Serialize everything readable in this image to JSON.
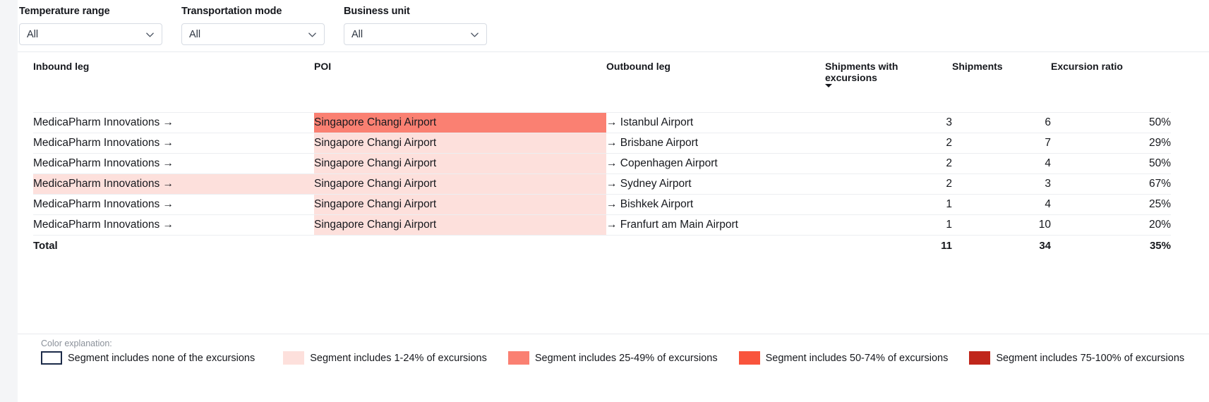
{
  "filters": [
    {
      "label": "Temperature range",
      "value": "All",
      "icon": "chevron-down-icon",
      "name": "temperature-range"
    },
    {
      "label": "Transportation mode",
      "value": "All",
      "icon": "chevron-down-icon",
      "name": "transportation-mode"
    },
    {
      "label": "Business unit",
      "value": "All",
      "icon": "chevron-down-icon",
      "name": "business-unit"
    }
  ],
  "table": {
    "columns": [
      {
        "label": "Inbound leg",
        "align": "left"
      },
      {
        "label": "POI",
        "align": "left"
      },
      {
        "label": "Outbound leg",
        "align": "left"
      },
      {
        "label": "Shipments with excursions",
        "align": "right",
        "sorted": "desc"
      },
      {
        "label": "Shipments",
        "align": "right"
      },
      {
        "label": "Excursion ratio",
        "align": "right"
      }
    ],
    "rows": [
      {
        "inbound": "MedicaPharm Innovations →",
        "poi": "Singapore Changi Airport",
        "outbound": "→ Istanbul Airport",
        "shipments_with_excursions": "3",
        "shipments": "6",
        "excursion_ratio": "50%",
        "inbound_color": "#ffffff",
        "poi_color": "#fa8072",
        "outbound_color": "#ffffff"
      },
      {
        "inbound": "MedicaPharm Innovations →",
        "poi": "Singapore Changi Airport",
        "outbound": "→ Brisbane Airport",
        "shipments_with_excursions": "2",
        "shipments": "7",
        "excursion_ratio": "29%",
        "inbound_color": "#ffffff",
        "poi_color": "#fde0dc",
        "outbound_color": "#ffffff"
      },
      {
        "inbound": "MedicaPharm Innovations →",
        "poi": "Singapore Changi Airport",
        "outbound": "→ Copenhagen Airport",
        "shipments_with_excursions": "2",
        "shipments": "4",
        "excursion_ratio": "50%",
        "inbound_color": "#ffffff",
        "poi_color": "#fde0dc",
        "outbound_color": "#ffffff"
      },
      {
        "inbound": "MedicaPharm Innovations →",
        "poi": "Singapore Changi Airport",
        "outbound": "→ Sydney Airport",
        "shipments_with_excursions": "2",
        "shipments": "3",
        "excursion_ratio": "67%",
        "inbound_color": "#fde0dc",
        "poi_color": "#fde0dc",
        "outbound_color": "#ffffff"
      },
      {
        "inbound": "MedicaPharm Innovations →",
        "poi": "Singapore Changi Airport",
        "outbound": "→ Bishkek Airport",
        "shipments_with_excursions": "1",
        "shipments": "4",
        "excursion_ratio": "25%",
        "inbound_color": "#ffffff",
        "poi_color": "#fde0dc",
        "outbound_color": "#ffffff"
      },
      {
        "inbound": "MedicaPharm Innovations →",
        "poi": "Singapore Changi Airport",
        "outbound": "→ Franfurt am Main Airport",
        "shipments_with_excursions": "1",
        "shipments": "10",
        "excursion_ratio": "20%",
        "inbound_color": "#ffffff",
        "poi_color": "#fde0dc",
        "outbound_color": "#ffffff"
      }
    ],
    "total": {
      "label": "Total",
      "shipments_with_excursions": "11",
      "shipments": "34",
      "excursion_ratio": "35%"
    }
  },
  "legend": {
    "title": "Color explanation:",
    "items": [
      {
        "color": "#ffffff",
        "outlined": true,
        "text": "Segment includes none of the excursions"
      },
      {
        "color": "#fde0dc",
        "outlined": false,
        "text": "Segment includes 1-24% of excursions"
      },
      {
        "color": "#fa8072",
        "outlined": false,
        "text": "Segment includes 25-49% of excursions"
      },
      {
        "color": "#f9543c",
        "outlined": false,
        "text": "Segment includes 50-74% of excursions"
      },
      {
        "color": "#c0261b",
        "outlined": false,
        "text": "Segment includes 75-100% of excursions"
      }
    ]
  }
}
